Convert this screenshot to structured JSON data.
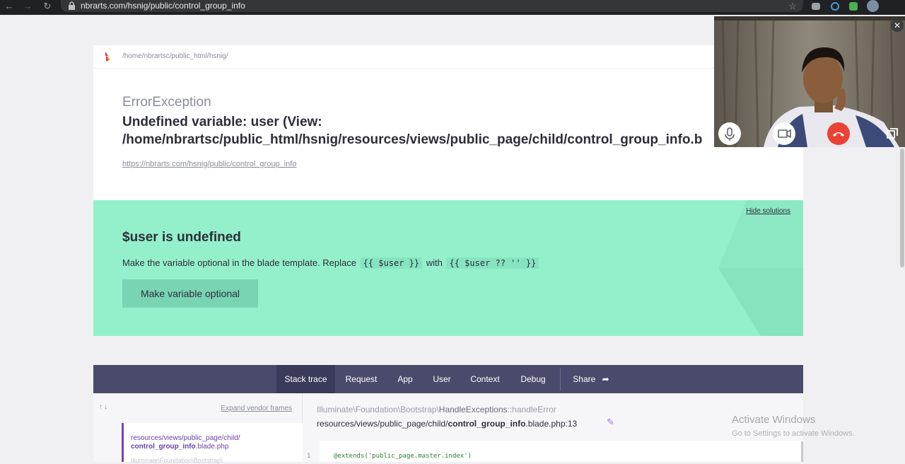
{
  "browser": {
    "url": "nbrarts.com/hsnig/public/control_group_info",
    "icons": [
      "back-icon",
      "forward-icon",
      "reload-icon",
      "lock-icon",
      "star-icon",
      "extension-icon",
      "puzzle-icon",
      "profile-avatar"
    ]
  },
  "error": {
    "breadcrumb": "/home/nbrartsc/public_html/hsnig/",
    "exception_class": "ErrorException",
    "message_line1": "Undefined variable: user (View:",
    "message_line2": "/home/nbrartsc/public_html/hsnig/resources/views/public_page/child/control_group_info.b",
    "url": "https://nbrarts.com/hsnig/public/control_group_info"
  },
  "solution": {
    "hide_label": "Hide solutions",
    "title": "$user is undefined",
    "desc_prefix": "Make the variable optional in the blade template. Replace",
    "code_from": "{{ $user }}",
    "desc_with": "with",
    "code_to": "{{ $user ?? '' }}",
    "button_label": "Make variable optional",
    "colors": {
      "panel": "#94f0cb",
      "button": "#79d4b3"
    }
  },
  "stack": {
    "tabs": [
      {
        "label": "Stack trace"
      },
      {
        "label": "Request"
      },
      {
        "label": "App"
      },
      {
        "label": "User"
      },
      {
        "label": "Context"
      },
      {
        "label": "Debug"
      },
      {
        "label": "Share"
      }
    ],
    "expand_vendor": "Expand vendor frames",
    "frame_path_line1": "resources/views/public_page/child/",
    "frame_path_line2_bold": "control_group_info",
    "frame_path_line2_rest": ".blade.php",
    "frame_next": "Illuminate\\Foundation\\Bootstrap\\",
    "code_class_prefix": "Illuminate\\Foundation\\Bootstrap\\",
    "code_class_name": "HandleExceptions",
    "code_class_method": "::handleError",
    "code_file_prefix": "resources/views/public_page/child/",
    "code_file_bold": "control_group_info",
    "code_file_suffix": ".blade.php:13",
    "line_number": "1",
    "code_line": "@extends('public_page.master.index')"
  },
  "watermark": {
    "title": "Activate Windows",
    "subtitle": "Go to Settings to activate Windows."
  },
  "video_call": {
    "controls": [
      "mic-icon",
      "camera-icon",
      "hang-up-icon",
      "popout-icon",
      "close-icon"
    ]
  }
}
